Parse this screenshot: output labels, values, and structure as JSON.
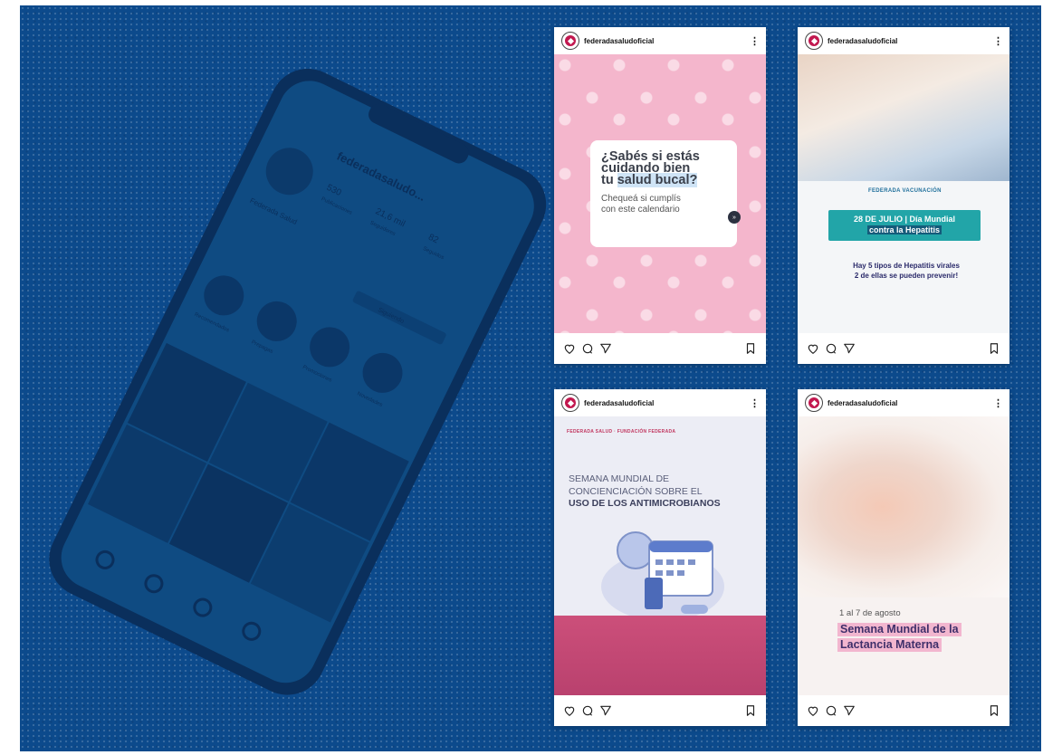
{
  "colors": {
    "background_blue": "#0c4a8c",
    "brand_pink": "#c2184f",
    "teal_banner": "#22a5a8"
  },
  "phone": {
    "profile_name": "federadasaludo...",
    "stats": [
      {
        "value": "530",
        "label": "Publicaciones"
      },
      {
        "value": "21,6 mil",
        "label": "Seguidores"
      },
      {
        "value": "82",
        "label": "Seguidos"
      }
    ],
    "bio_name": "Federada Salud",
    "follow_button": "Siguiendo",
    "highlights": [
      "Recomendados",
      "Prepagas",
      "Promociones",
      "Novedades"
    ]
  },
  "posts": [
    {
      "username": "federadasaludoficial",
      "title_line1": "¿Sabés si estás",
      "title_line2": "cuidando bien",
      "title_line3_prefix": "tu ",
      "title_line3_highlight": "salud bucal?",
      "subtitle_line1": "Chequeá si cumplís",
      "subtitle_line2": "con este calendario",
      "arrow": "»"
    },
    {
      "username": "federadasaludoficial",
      "brand": "FEDERADA VACUNACIÓN",
      "banner_line1": "28 DE JULIO | Día Mundial",
      "banner_line2": "contra la Hepatitis",
      "text_line1": "Hay 5 tipos de Hepatitis virales",
      "text_line2": "2 de ellas se pueden prevenir!"
    },
    {
      "username": "federadasaludoficial",
      "brands": "FEDERADA SALUD · FUNDACIÓN FEDERADA",
      "title_line1": "SEMANA MUNDIAL DE",
      "title_line2": "CONCIENCIACIÓN SOBRE EL",
      "title_line3": "USO DE LOS ANTIMICROBIANOS"
    },
    {
      "username": "federadasaludoficial",
      "date": "1 al 7 de agosto",
      "title_line1": "Semana Mundial de la",
      "title_line2": "Lactancia Materna"
    }
  ]
}
